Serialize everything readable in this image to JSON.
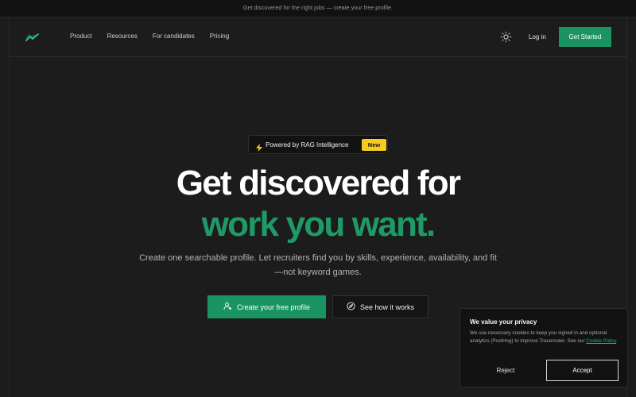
{
  "announcement": {
    "text": "Get discovered for the right jobs — create your free profile."
  },
  "nav": {
    "logo_icon": "trend-line-icon",
    "links": [
      "Product",
      "Resources",
      "For candidates",
      "Pricing"
    ],
    "theme_icon": "sun-icon",
    "login_label": "Log in",
    "cta_label": "Get Started"
  },
  "hero": {
    "badge_icon": "lightning-icon",
    "badge_text": "Powered by RAG Intelligence",
    "badge_tag": "New",
    "title_line1": "Get discovered for",
    "title_line2": "work you want.",
    "subtitle": "Create one searchable profile. Let recruiters find you by skills, experience, availability, and fit—not keyword games.",
    "primary_cta": "Create your free profile",
    "primary_icon": "user-add-icon",
    "secondary_cta": "See how it works",
    "secondary_icon": "compass-icon"
  },
  "cookie": {
    "title": "We value your privacy",
    "body": "We use necessary cookies to keep you signed in and optional analytics (PostHog) to improve Traceroster. See our",
    "link": "Cookie Policy",
    "tail": ".",
    "reject_label": "Reject",
    "accept_label": "Accept"
  },
  "colors": {
    "accent": "#1a9463",
    "accent_text": "#1f9a67",
    "badge_new": "#f5cb1f",
    "background": "#1c1c1c"
  }
}
